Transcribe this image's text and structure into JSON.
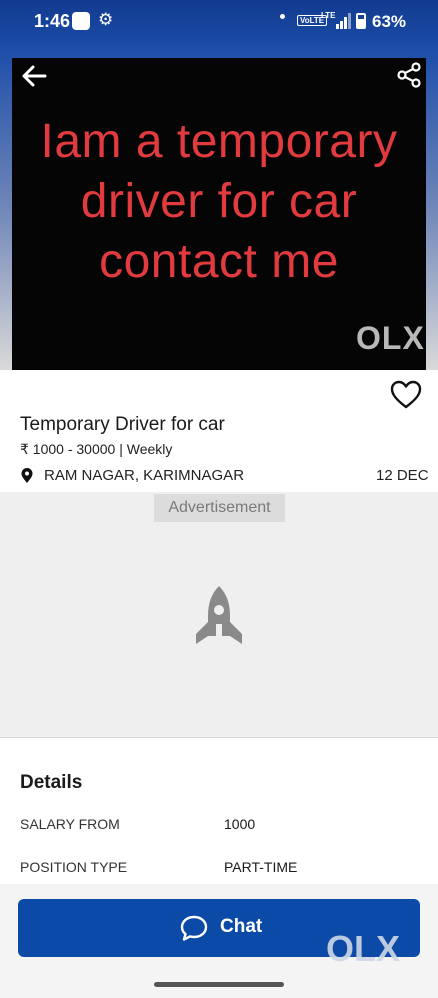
{
  "status_bar": {
    "time": "1:46",
    "volte": "VoLTE",
    "lte": "LTE",
    "battery_percent": "63%"
  },
  "hero": {
    "text_line1": "Iam a temporary",
    "text_line2": "driver for car",
    "text_line3": "contact me",
    "watermark": "OLX"
  },
  "listing": {
    "title": "Temporary Driver for car",
    "price": "₹ 1000 - 30000 | Weekly",
    "location": "RAM NAGAR, KARIMNAGAR",
    "date": "12 DEC"
  },
  "ad": {
    "label": "Advertisement"
  },
  "details": {
    "heading": "Details",
    "rows": [
      {
        "key": "SALARY FROM",
        "value": "1000"
      },
      {
        "key": "POSITION TYPE",
        "value": "PART-TIME"
      }
    ]
  },
  "chat": {
    "label": "Chat"
  },
  "brand_mark": "OLX",
  "colors": {
    "brand_blue": "#0b4aa6",
    "hero_text": "#e13b3f"
  }
}
